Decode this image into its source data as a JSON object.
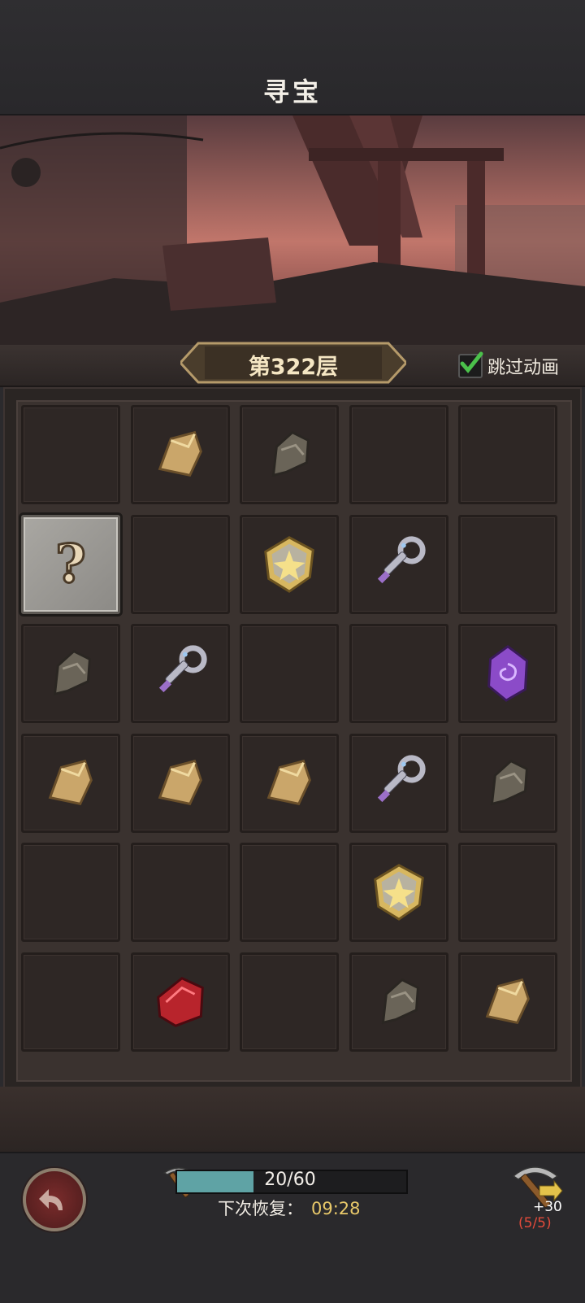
{
  "header": {
    "title": "寻宝"
  },
  "level": {
    "label": "第322层",
    "skip_label": "跳过动画",
    "skip_checked": true
  },
  "board": {
    "cols": 5,
    "cells": [
      "empty",
      "gold-ore",
      "stone-ore",
      "empty",
      "empty",
      "unknown",
      "empty",
      "gold-badge",
      "key",
      "empty",
      "stone-ore",
      "key",
      "empty",
      "empty",
      "purple-gem",
      "gold-ore",
      "gold-ore",
      "gold-ore",
      "key",
      "stone-ore",
      "empty",
      "empty",
      "empty",
      "gold-badge",
      "empty",
      "empty",
      "red-gem",
      "empty",
      "stone-ore",
      "gold-ore"
    ]
  },
  "stamina": {
    "text": "20/60",
    "current": 20,
    "max": 60
  },
  "recover": {
    "label": "下次恢复：",
    "time": "09:28"
  },
  "pickaxe_shop": {
    "plus": "+30",
    "count": "(5/5)"
  },
  "colors": {
    "fill": "#5fa3a5",
    "timer": "#e9c96a",
    "count": "#e24a3a"
  }
}
